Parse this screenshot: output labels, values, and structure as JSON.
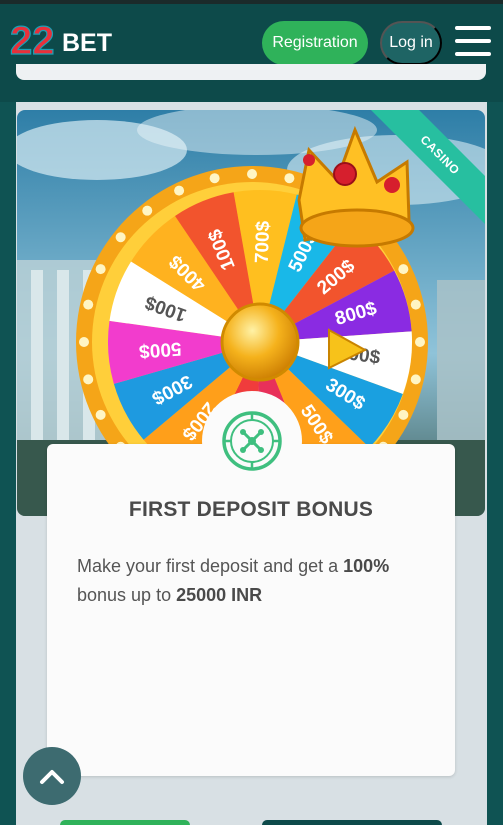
{
  "header": {
    "logo_number": "22",
    "logo_text": "BET",
    "registration_label": "Registration",
    "login_label": "Log in"
  },
  "banner": {
    "ribbon_label": "CASINO",
    "wheel_labels": [
      "700$",
      "500$",
      "200$",
      "800$",
      "100$",
      "300$",
      "500$",
      "100$",
      "800$",
      "200$",
      "300$",
      "500$",
      "100$",
      "400$",
      "100$"
    ]
  },
  "promo": {
    "title": "FIRST DEPOSIT BONUS",
    "text_part1": "Make your first deposit and get a ",
    "text_bold1": "100%",
    "text_part2": " bonus up to ",
    "text_bold2": "25000 INR"
  },
  "colors": {
    "header_bg": "#0d4a4a",
    "registration_bg": "#2fb25a",
    "ribbon": "#27bfa0",
    "icon_green": "#3fbf7f"
  },
  "icons": {
    "roulette": "roulette-icon",
    "scroll_top": "chevron-up-icon",
    "menu": "hamburger-menu-icon"
  }
}
